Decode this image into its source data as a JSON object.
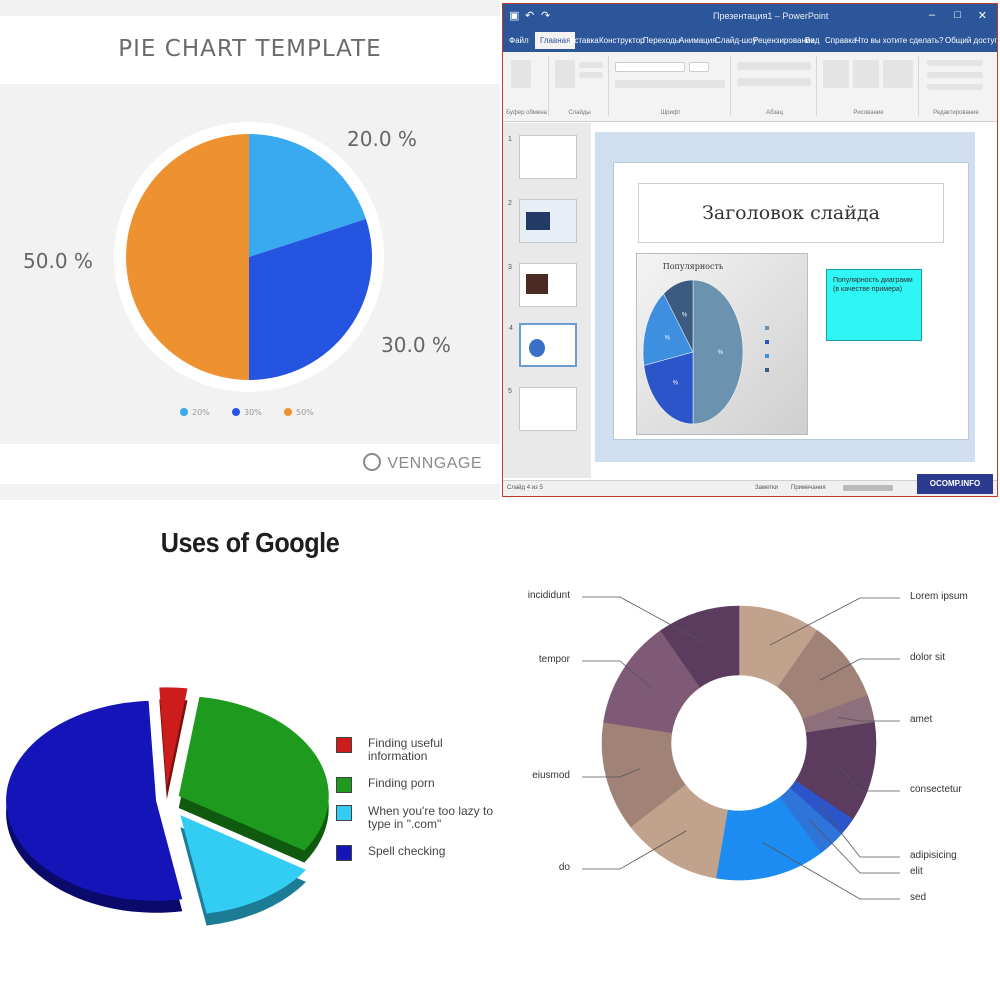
{
  "top_left": {
    "title": "PIE CHART TEMPLATE",
    "brand": "VENNGAGE",
    "legend": [
      {
        "label": "20%",
        "color": "#39a9f0"
      },
      {
        "label": "30%",
        "color": "#2554e0"
      },
      {
        "label": "50%",
        "color": "#ee9231"
      }
    ]
  },
  "powerpoint": {
    "window_title": "Презентация1 – PowerPoint",
    "tabs": [
      "Файл",
      "Главная",
      "Вставка",
      "Конструктор",
      "Переходы",
      "Анимация",
      "Слайд-шоу",
      "Рецензирование",
      "Вид",
      "Справка",
      "Что вы хотите сделать?",
      "Общий доступ"
    ],
    "active_tab": "Главная",
    "ribbon_groups": [
      "Буфер обмена",
      "Слайды",
      "Шрифт",
      "Абзац",
      "Рисование",
      "Редактирование"
    ],
    "slide_numbers": [
      "1",
      "2",
      "3",
      "4",
      "5"
    ],
    "slide_title": "Заголовок слайда",
    "chart_title": "Популярность",
    "callout_text": "Популярность диаграмм (в качестве примера)",
    "status_left": "Слайд 4 из 5",
    "status_notes": "Заметки",
    "status_comments": "Примечания",
    "watermark": "OCOMP.INFO"
  },
  "chart_data": [
    {
      "type": "pie",
      "title": "PIE CHART TEMPLATE",
      "labels": [
        "20.0 %",
        "30.0 %",
        "50.0 %"
      ],
      "values": [
        20,
        30,
        50
      ],
      "colors": [
        "#39a9f0",
        "#2554e0",
        "#ee9231"
      ],
      "legend_position": "bottom"
    },
    {
      "type": "pie",
      "title": "Популярность",
      "values": [
        50,
        22,
        18,
        10
      ],
      "data_labels": [
        "%",
        "%",
        "%",
        "%"
      ],
      "colors": [
        "#6b93b0",
        "#2c55c9",
        "#3e8fe0",
        "#3c5a82"
      ],
      "legend_position": "right"
    },
    {
      "type": "pie",
      "title": "Uses of Google",
      "labels": [
        "Finding useful information",
        "Finding porn",
        "When you're too lazy to type in \".com\"",
        "Spell checking"
      ],
      "values": [
        3,
        32,
        13,
        52
      ],
      "colors": [
        "#cc1c1c",
        "#1e9a1e",
        "#33ccf2",
        "#1414b8"
      ],
      "legend_position": "right"
    },
    {
      "type": "pie",
      "subtype": "donut",
      "labels": [
        "Lorem ipsum",
        "dolor sit",
        "amet",
        "consectetur",
        "adipisicing",
        "elit",
        "sed",
        "do",
        "eiusmod",
        "tempor",
        "incididunt"
      ],
      "values": [
        9,
        9,
        3,
        11,
        2,
        3,
        12,
        11,
        12,
        12,
        9
      ],
      "colors": [
        "#c0a28d",
        "#a08276",
        "#8e6f7c",
        "#5b3b5e",
        "#2c55c9",
        "#2f74d8",
        "#1c8cf2",
        "#c0a28d",
        "#a08276",
        "#7e5a76",
        "#5b3b5e"
      ]
    }
  ]
}
